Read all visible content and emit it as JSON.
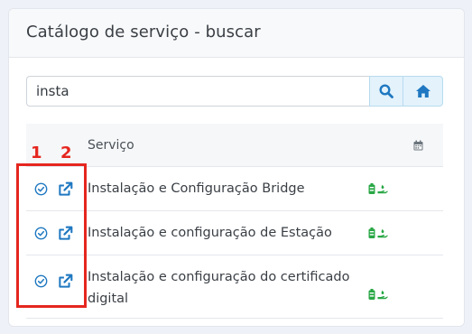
{
  "panel": {
    "title": "Catálogo de serviço - buscar"
  },
  "search": {
    "value": "insta",
    "search_icon": "search-icon",
    "home_icon": "home-icon"
  },
  "table": {
    "header_service": "Serviço",
    "header_icon": "calendar-icon",
    "rows": [
      {
        "label": "Instalação e Configuração Bridge"
      },
      {
        "label": "Instalação e configuração de Estação"
      },
      {
        "label": "Instalação e configuração do certificado digital"
      }
    ]
  },
  "annotations": {
    "label_1": "1",
    "label_2": "2",
    "color": "#e5261f"
  },
  "colors": {
    "accent": "#1f78c1",
    "tag_green": "#28a745",
    "background": "#eef1f7"
  }
}
